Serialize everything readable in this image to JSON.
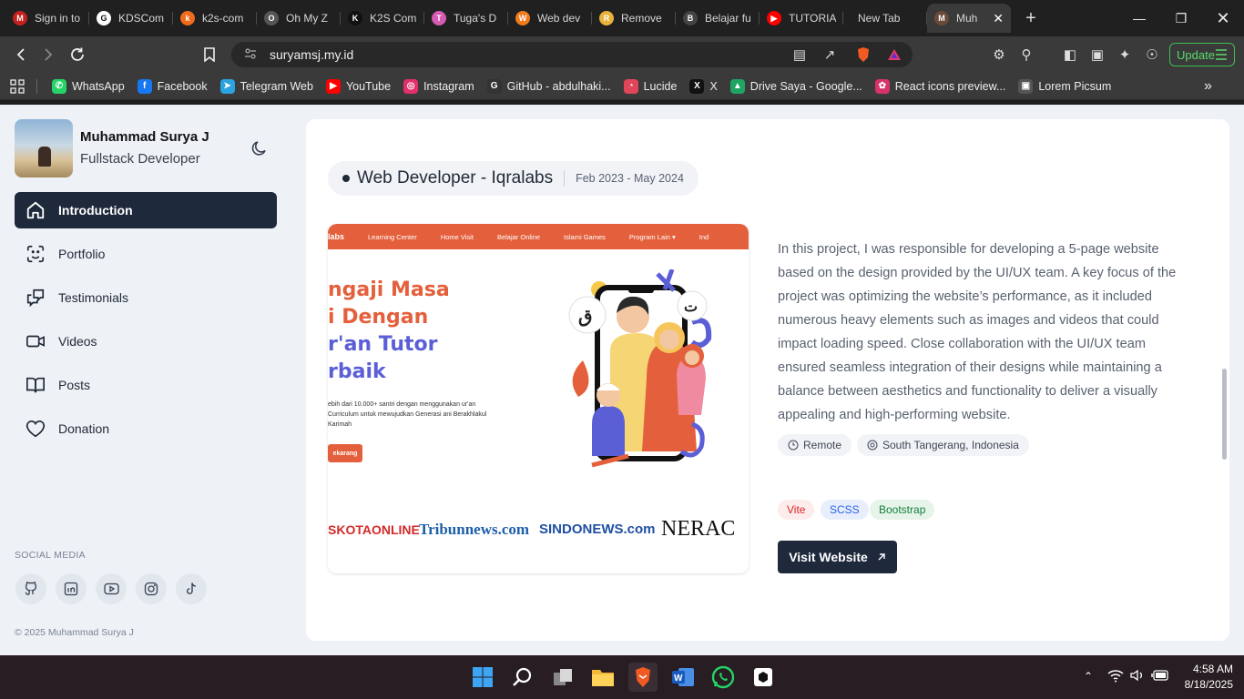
{
  "browser": {
    "tabs": [
      {
        "title": "Sign in to",
        "color": "#c5221f",
        "glyph": "M"
      },
      {
        "title": "KDSCom",
        "color": "#ffffff",
        "glyph": "G"
      },
      {
        "title": "k2s-com",
        "color": "#f06b1b",
        "glyph": "k"
      },
      {
        "title": "Oh My Z",
        "color": "#555555",
        "glyph": "O"
      },
      {
        "title": "K2S Com",
        "color": "#111111",
        "glyph": "K"
      },
      {
        "title": "Tuga's D",
        "color": "#d65ab1",
        "glyph": "T"
      },
      {
        "title": "Web dev",
        "color": "#f07b1d",
        "glyph": "W"
      },
      {
        "title": "Remove",
        "color": "#e8b23b",
        "glyph": "R"
      },
      {
        "title": "Belajar fu",
        "color": "#444444",
        "glyph": "B"
      },
      {
        "title": "TUTORIA",
        "color": "#ff0000",
        "glyph": "▶"
      },
      {
        "title": "New Tab",
        "color": "",
        "glyph": ""
      },
      {
        "title": "Muh",
        "color": "#6b4a3a",
        "glyph": "M"
      }
    ],
    "address": "suryamsj.my.id",
    "update_label": "Update",
    "bookmarks": [
      {
        "label": "WhatsApp",
        "color": "#25d366",
        "glyph": "✆"
      },
      {
        "label": "Facebook",
        "color": "#1877f2",
        "glyph": "f"
      },
      {
        "label": "Telegram Web",
        "color": "#2aa3e0",
        "glyph": "➤"
      },
      {
        "label": "YouTube",
        "color": "#ff0000",
        "glyph": "▶"
      },
      {
        "label": "Instagram",
        "color": "#e1306c",
        "glyph": "◎"
      },
      {
        "label": "GitHub - abdulhaki...",
        "color": "#333333",
        "glyph": "G"
      },
      {
        "label": "Lucide",
        "color": "#e0455a",
        "glyph": "◔"
      },
      {
        "label": "X",
        "color": "#111111",
        "glyph": "X"
      },
      {
        "label": "Drive Saya - Google...",
        "color": "#1fa463",
        "glyph": "▲"
      },
      {
        "label": "React icons preview...",
        "color": "#d6336c",
        "glyph": "✿"
      },
      {
        "label": "Lorem Picsum",
        "color": "#555555",
        "glyph": "▣"
      }
    ]
  },
  "profile": {
    "name": "Muhammad Surya J",
    "role": "Fullstack Developer"
  },
  "nav": [
    {
      "label": "Introduction",
      "icon": "home-icon"
    },
    {
      "label": "Portfolio",
      "icon": "scan-face-icon"
    },
    {
      "label": "Testimonials",
      "icon": "messages-icon"
    },
    {
      "label": "Videos",
      "icon": "video-icon"
    },
    {
      "label": "Posts",
      "icon": "book-open-icon"
    },
    {
      "label": "Donation",
      "icon": "heart-icon"
    }
  ],
  "social": {
    "title": "SOCIAL MEDIA",
    "icons": [
      "github-icon",
      "linkedin-icon",
      "youtube-icon",
      "instagram-icon",
      "tiktok-icon"
    ]
  },
  "copyright": "© 2025 Muhammad Surya J",
  "experience": {
    "role": "Web Developer - Iqralabs",
    "dates": "Feb 2023 - May 2024",
    "description": "In this project, I was responsible for developing a 5-page website based on the design provided by the UI/UX team. A key focus of the project was optimizing the website’s performance, as it included numerous heavy elements such as images and videos that could impact loading speed. Close collaboration with the UI/UX team ensured seamless integration of their designs while maintaining a balance between aesthetics and functionality to deliver a visually appealing and high-performing website.",
    "work_type": "Remote",
    "location": "South Tangerang, Indonesia",
    "tech": [
      {
        "label": "Vite",
        "color": "#dc2626",
        "bg": "#fdecec"
      },
      {
        "label": "SCSS",
        "color": "#2563eb",
        "bg": "#e8eefc"
      },
      {
        "label": "Bootstrap",
        "color": "#15803d",
        "bg": "#e6f4ea"
      }
    ],
    "visit_label": "Visit Website"
  },
  "preview": {
    "nav": [
      "labs",
      "Learning Center",
      "Home Visit",
      "Belajar Online",
      "Islami Games",
      "Program Lain ▾",
      "Ind"
    ],
    "hero_lines": [
      "ngaji Masa",
      "i Dengan",
      "r'an Tutor",
      "rbaik"
    ],
    "hero_sub": "ebih dari 10.000+ santri dengan menggunakan ur'an Curriculum untuk mewujudkan Generasi ani Berakhlakul Karimah",
    "hero_btn": "ekarang",
    "logos": [
      {
        "text": "SKOTAONLINE",
        "color": "#d42a2a"
      },
      {
        "text": "Tribunnews.com",
        "color": "#1e5fa8"
      },
      {
        "text": "SINDONEWS.com",
        "color": "#1f4fa3"
      },
      {
        "text": "NERAC",
        "color": "#111111"
      }
    ]
  },
  "system": {
    "time": "4:58 AM",
    "date": "8/18/2025"
  }
}
